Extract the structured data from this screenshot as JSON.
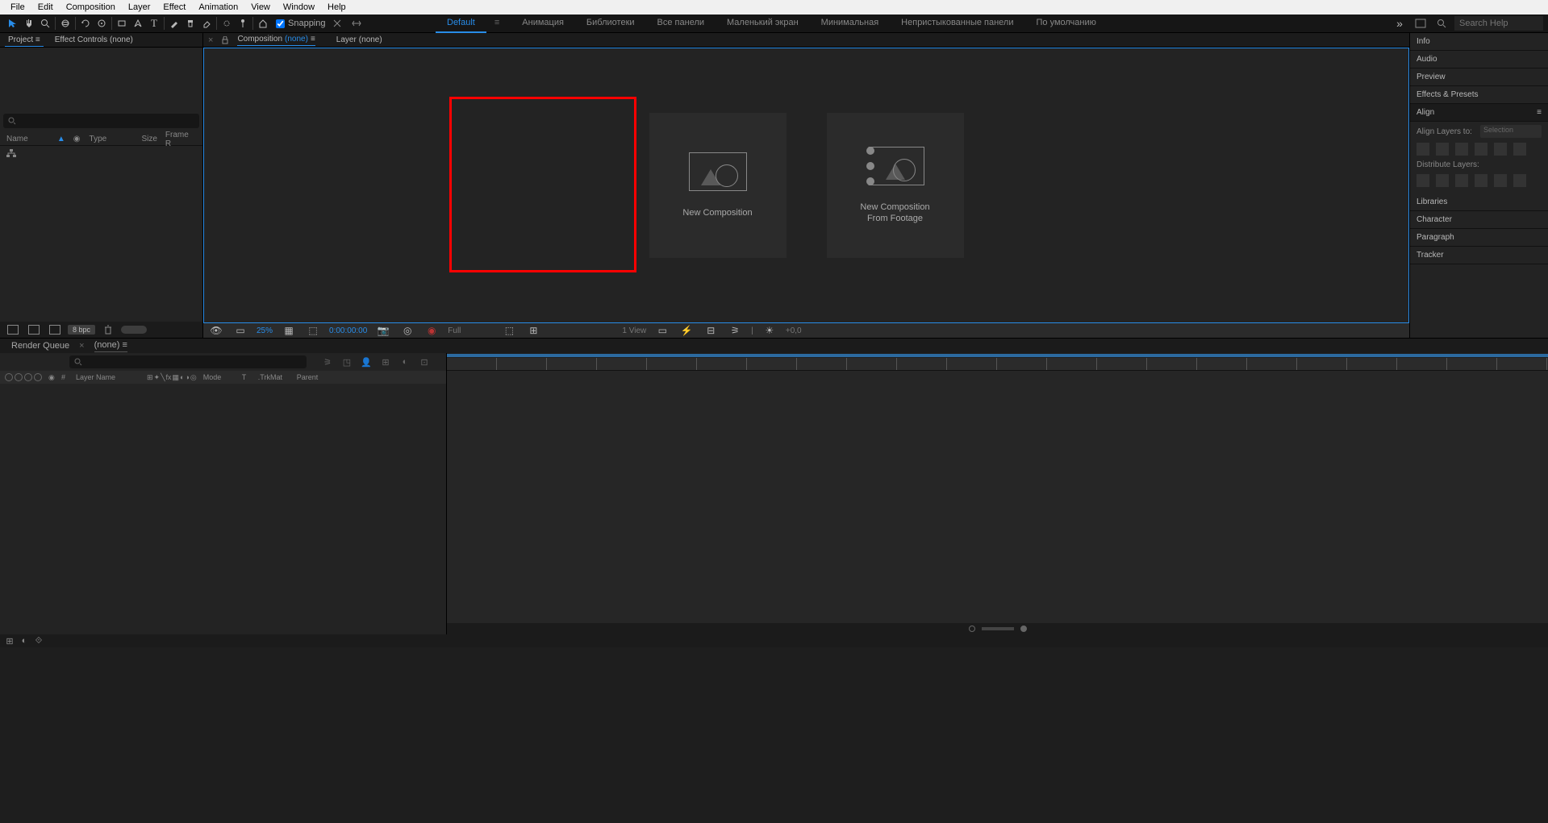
{
  "menubar": {
    "items": [
      "File",
      "Edit",
      "Composition",
      "Layer",
      "Effect",
      "Animation",
      "View",
      "Window",
      "Help"
    ]
  },
  "toolbar": {
    "snapping_label": "Snapping",
    "workspaces": [
      "Default",
      "Анимация",
      "Библиотеки",
      "Все панели",
      "Маленький экран",
      "Минимальная",
      "Непристыкованные панели",
      "По умолчанию"
    ],
    "active_workspace": 0,
    "search_placeholder": "Search Help"
  },
  "left_panel": {
    "tabs": {
      "project": "Project",
      "effect_controls": "Effect Controls",
      "effect_controls_target": "(none)"
    },
    "columns": {
      "name": "Name",
      "type": "Type",
      "size": "Size",
      "framerate": "Frame R"
    },
    "footer": {
      "bpc": "8 bpc"
    }
  },
  "center_panel": {
    "tabs": {
      "composition": "Composition",
      "composition_target": "(none)",
      "layer": "Layer",
      "layer_target": "(none)"
    },
    "cards": {
      "new_comp": "New Composition",
      "from_footage": "New Composition\nFrom Footage"
    },
    "footer": {
      "zoom": "25%",
      "time": "0:00:00:00",
      "res": "Full",
      "views": "1 View",
      "exposure": "+0,0"
    }
  },
  "right_panels": {
    "info": "Info",
    "audio": "Audio",
    "preview": "Preview",
    "effects_presets": "Effects & Presets",
    "align": {
      "title": "Align",
      "align_to_label": "Align Layers to:",
      "align_to_value": "Selection",
      "distribute_label": "Distribute Layers:"
    },
    "libraries": "Libraries",
    "character": "Character",
    "paragraph": "Paragraph",
    "tracker": "Tracker"
  },
  "timeline": {
    "tabs": {
      "render_queue": "Render Queue",
      "comp": "(none)"
    },
    "columns": {
      "hash": "#",
      "layer_name": "Layer Name",
      "mode": "Mode",
      "t": "T",
      "trkmat": ".TrkMat",
      "parent": "Parent"
    }
  }
}
